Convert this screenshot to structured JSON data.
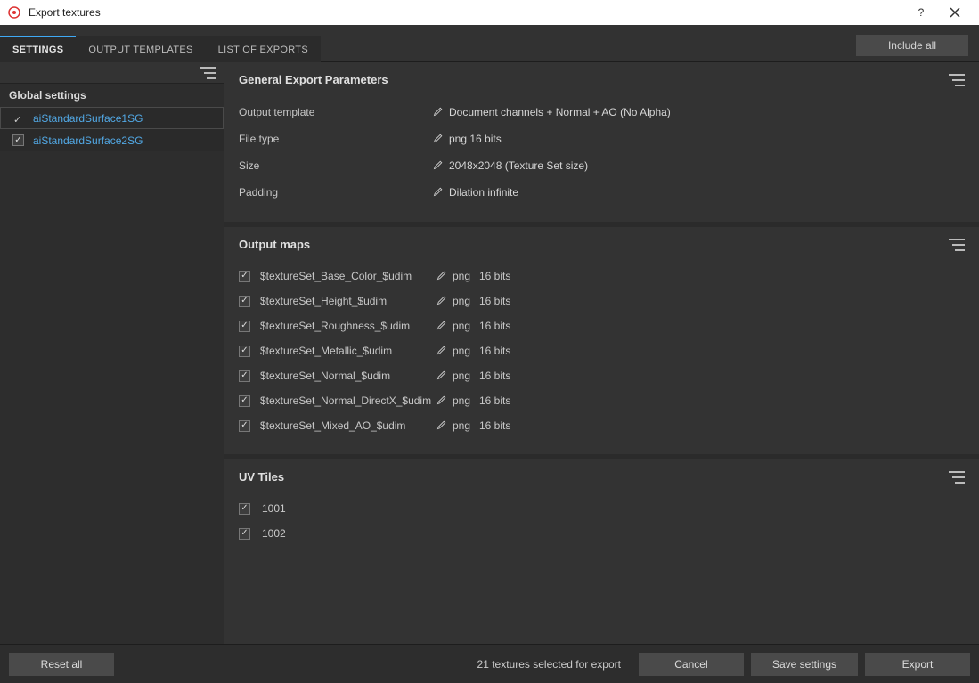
{
  "window": {
    "title": "Export textures"
  },
  "tabs": [
    {
      "label": "SETTINGS",
      "active": true
    },
    {
      "label": "OUTPUT TEMPLATES",
      "active": false
    },
    {
      "label": "LIST OF EXPORTS",
      "active": false
    }
  ],
  "include_all_label": "Include all",
  "sidebar": {
    "title": "Global settings",
    "texture_sets": [
      {
        "name": "aiStandardSurface1SG",
        "checked": true,
        "active": true
      },
      {
        "name": "aiStandardSurface2SG",
        "checked": true,
        "active": false
      }
    ]
  },
  "sections": {
    "general": {
      "title": "General Export Parameters",
      "params": [
        {
          "label": "Output template",
          "value": "Document channels + Normal + AO (No Alpha)"
        },
        {
          "label": "File type",
          "value": "png   16 bits"
        },
        {
          "label": "Size",
          "value": "2048x2048 (Texture Set size)"
        },
        {
          "label": "Padding",
          "value": "Dilation infinite"
        }
      ]
    },
    "maps": {
      "title": "Output maps",
      "rows": [
        {
          "checked": true,
          "name": "$textureSet_Base_Color_$udim",
          "ft": "png",
          "bits": "16 bits"
        },
        {
          "checked": true,
          "name": "$textureSet_Height_$udim",
          "ft": "png",
          "bits": "16 bits"
        },
        {
          "checked": true,
          "name": "$textureSet_Roughness_$udim",
          "ft": "png",
          "bits": "16 bits"
        },
        {
          "checked": true,
          "name": "$textureSet_Metallic_$udim",
          "ft": "png",
          "bits": "16 bits"
        },
        {
          "checked": true,
          "name": "$textureSet_Normal_$udim",
          "ft": "png",
          "bits": "16 bits"
        },
        {
          "checked": true,
          "name": "$textureSet_Normal_DirectX_$udim",
          "ft": "png",
          "bits": "16 bits"
        },
        {
          "checked": true,
          "name": "$textureSet_Mixed_AO_$udim",
          "ft": "png",
          "bits": "16 bits"
        }
      ]
    },
    "tiles": {
      "title": "UV Tiles",
      "rows": [
        {
          "checked": true,
          "id": "1001"
        },
        {
          "checked": true,
          "id": "1002"
        }
      ]
    }
  },
  "footer": {
    "reset": "Reset all",
    "status": "21 textures selected for export",
    "cancel": "Cancel",
    "save": "Save settings",
    "export": "Export"
  }
}
